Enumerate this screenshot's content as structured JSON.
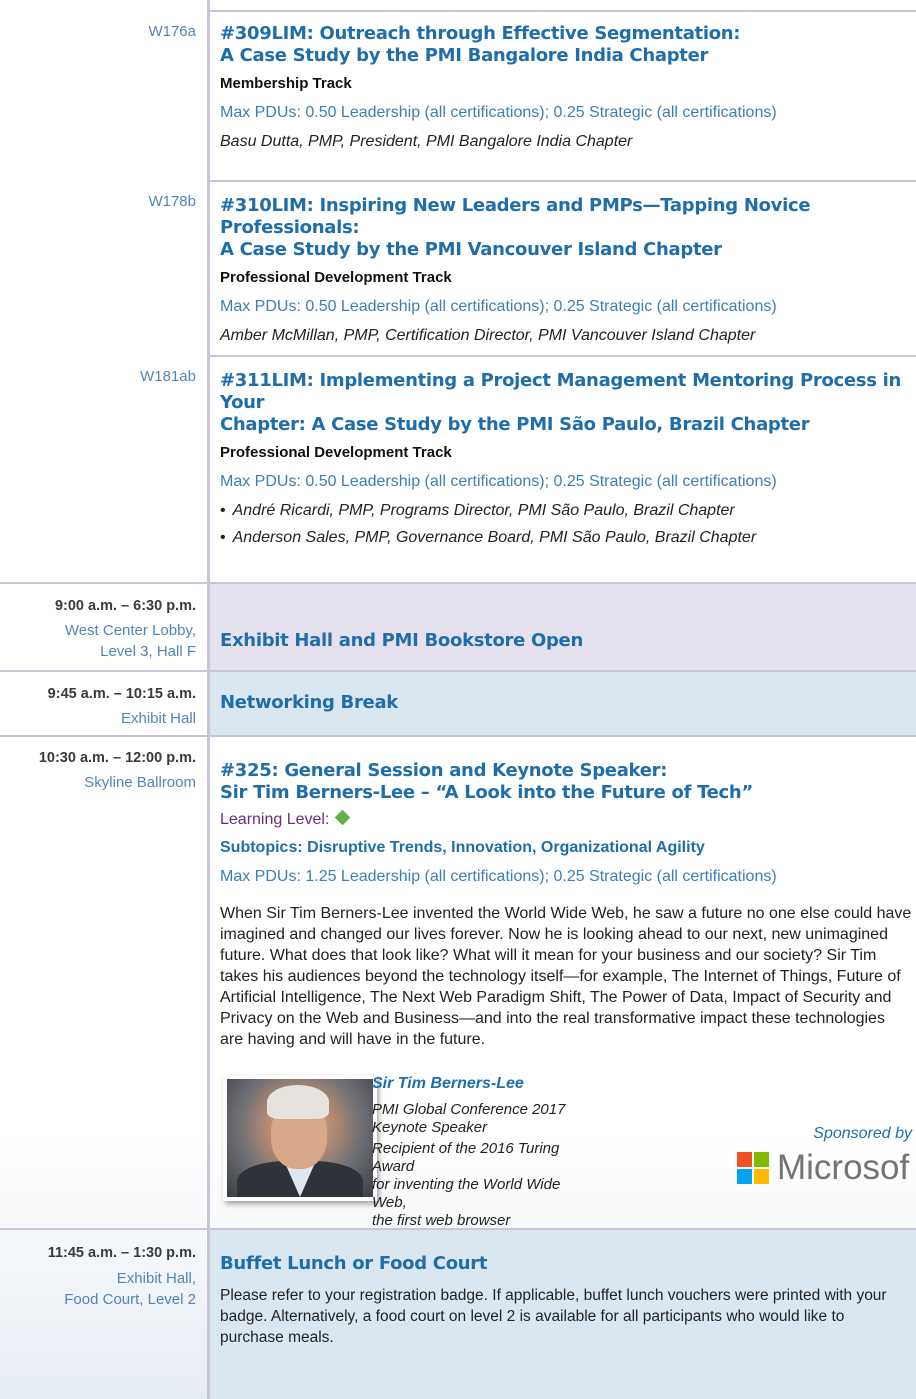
{
  "sessions": [
    {
      "room": "W176a",
      "title_line1": "#309LIM: Outreach through Effective Segmentation:",
      "title_line2": "A Case Study by the PMI Bangalore India Chapter",
      "track": "Membership Track",
      "pdus": "Max PDUs: 0.50 Leadership (all certifications); 0.25 Strategic (all certifications)",
      "speakers": [
        "Basu Dutta, PMP, President, PMI Bangalore India Chapter"
      ]
    },
    {
      "room": "W178b",
      "title_line1": "#310LIM: Inspiring New Leaders and PMPs—Tapping Novice Professionals:",
      "title_line2": "A Case Study by the PMI Vancouver Island Chapter",
      "track": "Professional Development Track",
      "pdus": "Max PDUs: 0.50 Leadership (all certifications); 0.25 Strategic (all certifications)",
      "speakers": [
        "Amber McMillan, PMP, Certification Director, PMI Vancouver Island Chapter"
      ]
    },
    {
      "room": "W181ab",
      "title_line1": "#311LIM: Implementing a Project Management Mentoring Process in Your",
      "title_line2": "Chapter: A Case Study by the PMI São Paulo, Brazil Chapter",
      "track": "Professional Development Track",
      "pdus": "Max PDUs: 0.50 Leadership (all certifications); 0.25 Strategic (all certifications)",
      "speakers": [
        "André Ricardi, PMP, Programs Director, PMI São Paulo, Brazil Chapter",
        "Anderson Sales, PMP, Governance Board, PMI São Paulo, Brazil Chapter"
      ]
    }
  ],
  "exhibit": {
    "time": "9:00 a.m. – 6:30 p.m.",
    "location_line1": "West Center Lobby,",
    "location_line2": "Level 3, Hall F",
    "title": "Exhibit Hall and PMI Bookstore Open"
  },
  "networking": {
    "time": "9:45 a.m. – 10:15 a.m.",
    "location": "Exhibit Hall",
    "title": "Networking Break"
  },
  "keynote": {
    "time": "10:30 a.m. – 12:00 p.m.",
    "location": "Skyline Ballroom",
    "title_line1": "#325: General Session and Keynote Speaker:",
    "title_line2": "Sir Tim Berners-Lee – “A Look into the Future of Tech”",
    "learning_level_label": "Learning Level:",
    "subtopics": "Subtopics: Disruptive Trends, Innovation, Organizational Agility",
    "pdus": "Max PDUs: 1.25 Leadership (all certifications); 0.25 Strategic (all certifications)",
    "description": "When Sir Tim Berners-Lee invented the World Wide Web, he saw a future no one else could have imagined and changed our lives forever. Now he is looking ahead to our next, new unimagined future. What does that look like? What will it mean for your business and our society? Sir Tim takes his audiences beyond the technology itself—for example, The Internet of Things, Future of Artificial Intelligence, The Next Web Paradigm Shift, The Power of Data, Impact of Security and Privacy on the Web and Business—and into the real transformative impact these technologies are having and will have in the future.",
    "speaker_name": "Sir Tim Berners-Lee",
    "speaker_role_line1": "PMI Global Conference 2017",
    "speaker_role_line2": "Keynote Speaker",
    "award_line1": "Recipient of the 2016 Turing Award",
    "award_line2": "for inventing the World Wide Web,",
    "award_line3": "the first web browser",
    "sponsored_by": "Sponsored by",
    "sponsor_logo_text": "Microsof"
  },
  "lunch": {
    "time": "11:45 a.m. – 1:30 p.m.",
    "location_line1": "Exhibit Hall,",
    "location_line2": "Food Court, Level 2",
    "title": "Buffet Lunch or Food Court",
    "description": "Please refer to your registration badge. If applicable, buffet lunch vouchers were printed with your badge.  Alternatively, a food court on level 2 is available for all participants who would like to purchase meals."
  },
  "colors": {
    "title_blue": "#1f6eab",
    "room_blue": "#4f86b8",
    "purple_band": "#e6e1ee",
    "blue_band": "#dbe7f0",
    "rule": "#c9c5d6",
    "diamond_green": "#61b148"
  }
}
